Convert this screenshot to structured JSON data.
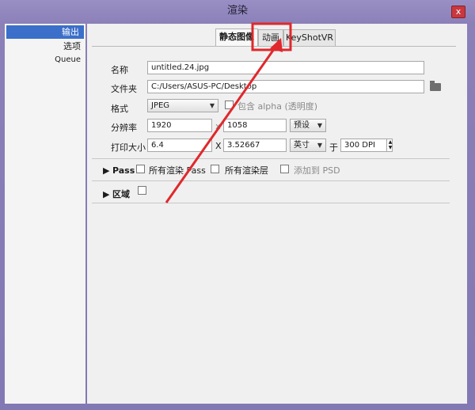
{
  "window": {
    "title": "渲染",
    "close": "x"
  },
  "sidebar": {
    "items": [
      {
        "label": "输出"
      },
      {
        "label": "选项"
      },
      {
        "label": "Queue"
      }
    ]
  },
  "tabs": [
    {
      "label": "静态图像"
    },
    {
      "label": "动画"
    },
    {
      "label": "KeyShotVR"
    }
  ],
  "form": {
    "name_label": "名称",
    "name_value": "untitled.24.jpg",
    "folder_label": "文件夹",
    "folder_value": "C:/Users/ASUS-PC/Desktop",
    "format_label": "格式",
    "format_value": "JPEG",
    "alpha_label": "包含 alpha (透明度)",
    "res_label": "分辨率",
    "res_w": "1920",
    "res_x": "x",
    "res_h": "1058",
    "preset_label": "预设",
    "print_label": "打印大小",
    "print_w": "6.4",
    "print_x": "X",
    "print_h": "3.52667",
    "unit_value": "英寸",
    "at_label": "于",
    "dpi_value": "300 DPI"
  },
  "pass": {
    "label": "Pass",
    "all_passes": "所有渲染 Pass",
    "all_layers": "所有渲染层",
    "add_psd": "添加到 PSD"
  },
  "region": {
    "label": "区域"
  },
  "annotation": {
    "color": "#e0282c"
  }
}
